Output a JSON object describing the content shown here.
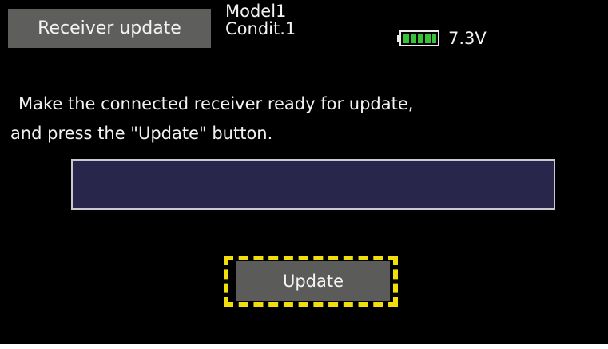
{
  "header": {
    "title": "Receiver update",
    "model_name": "Model1",
    "condition": "Condit.1",
    "battery_voltage": "7.3V",
    "battery_level": 1.0,
    "battery_icon": "battery-full-icon"
  },
  "main": {
    "instruction_line1": "Make the connected receiver ready for update,",
    "instruction_line2": "and press the \"Update\" button.",
    "update_button_label": "Update",
    "progress": 0
  },
  "colors": {
    "screen_background": "#000000",
    "tab_background": "#5e5e5c",
    "progress_background": "#29264b",
    "focus_highlight": "#f2de0b",
    "battery_green": "#36c33a"
  }
}
